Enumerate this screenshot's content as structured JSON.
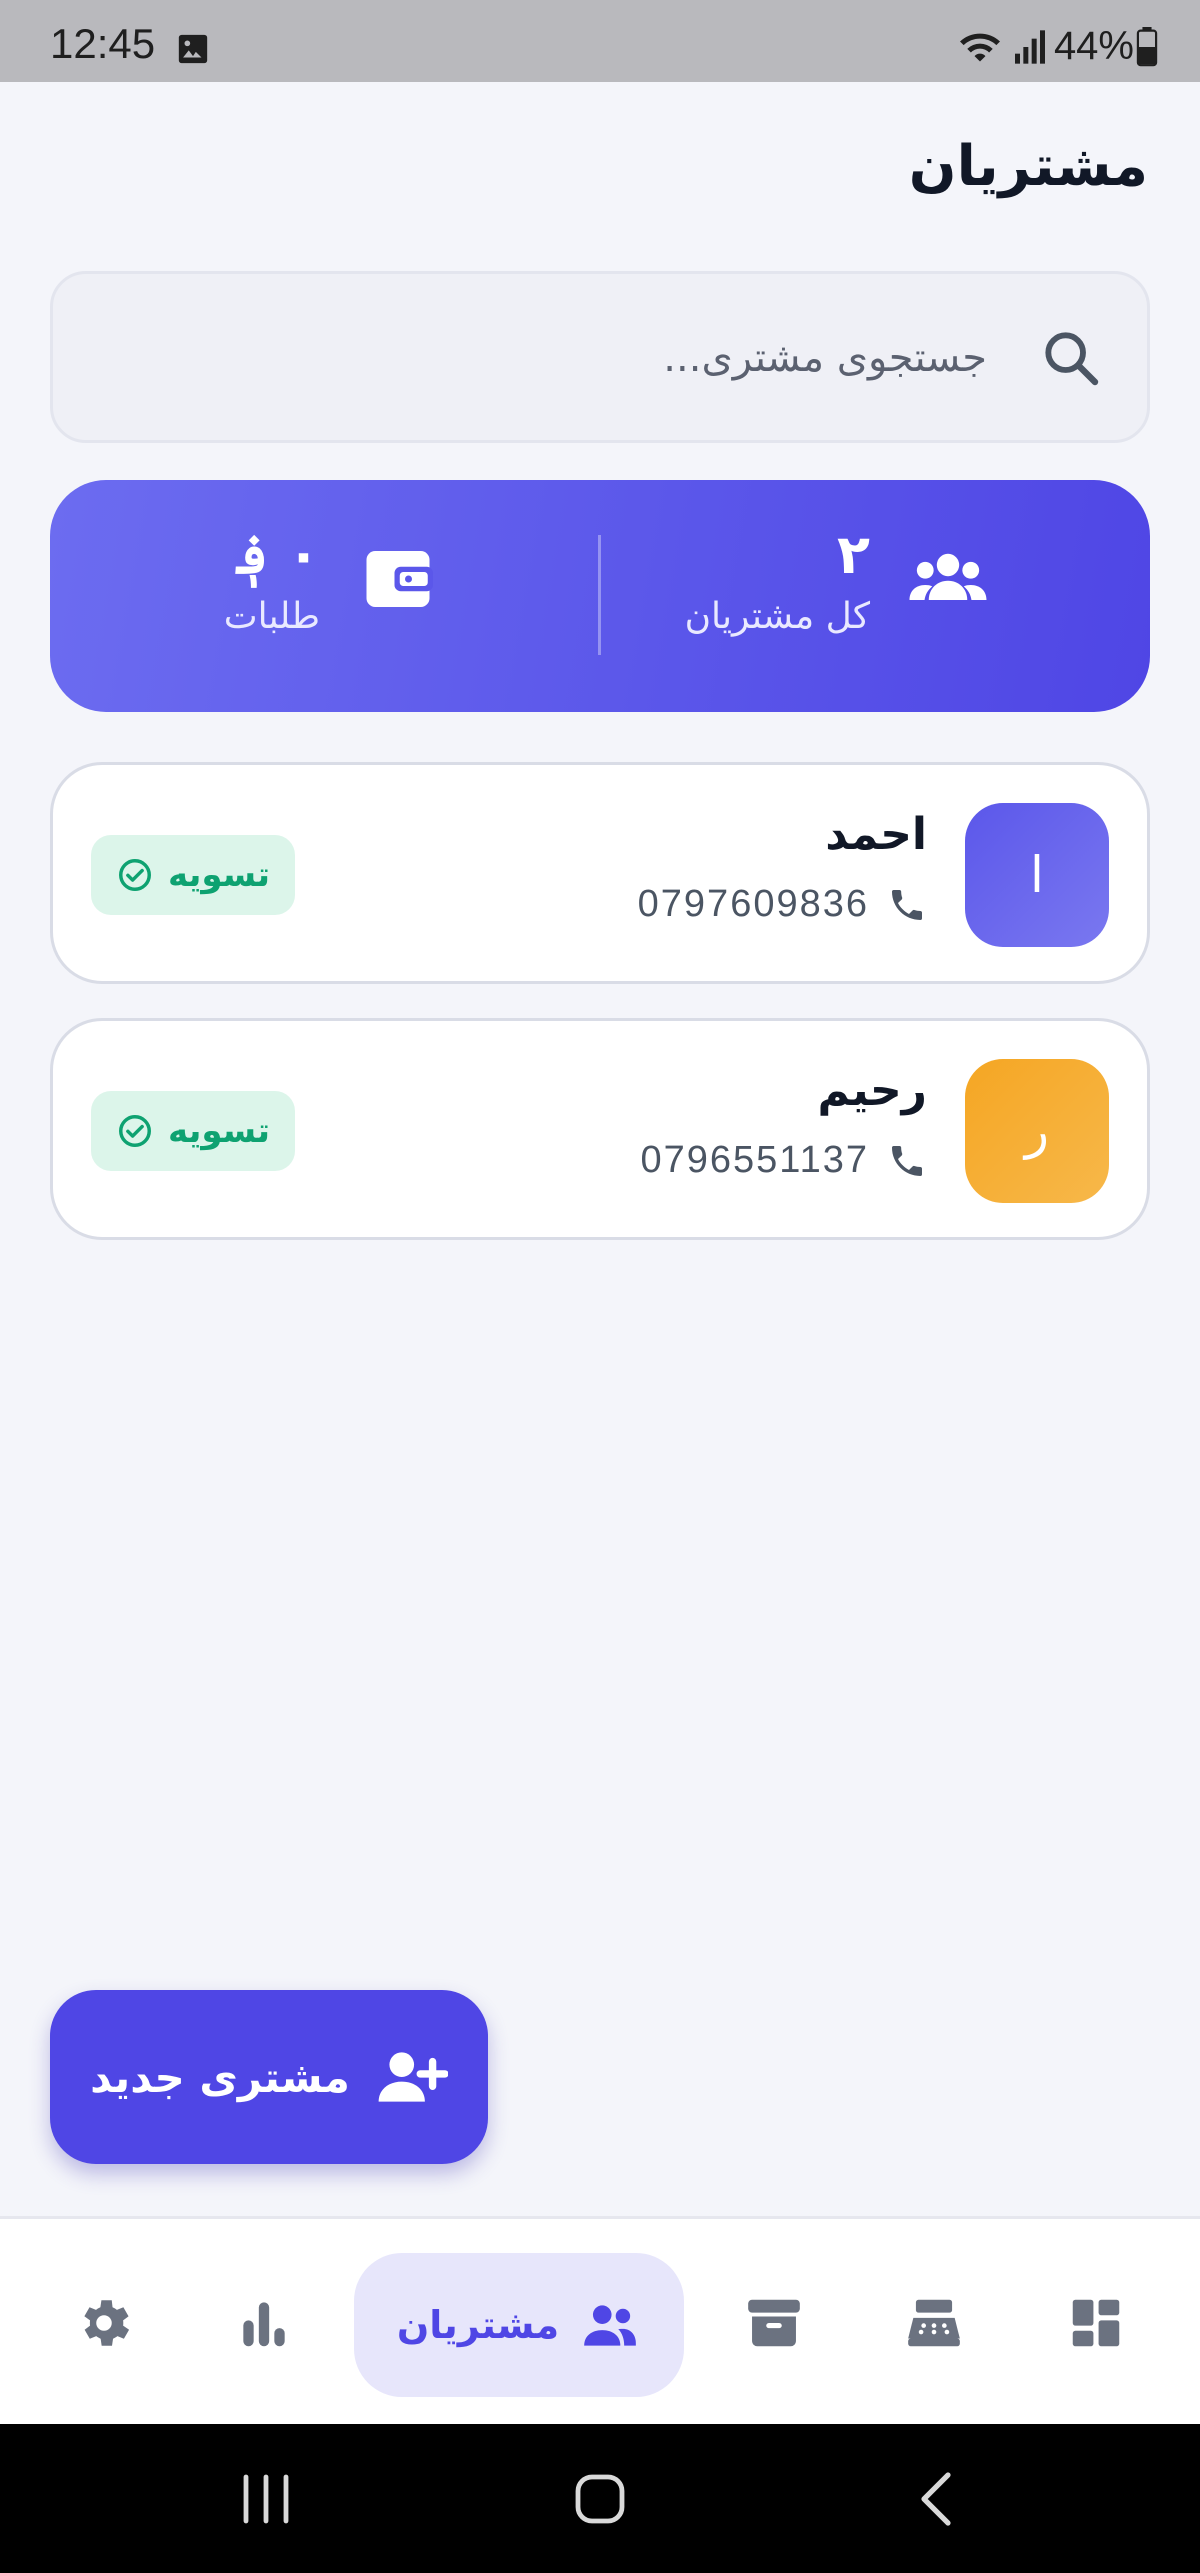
{
  "status_bar": {
    "time": "12:45",
    "battery": "44%"
  },
  "page": {
    "title": "مشتریان"
  },
  "search": {
    "placeholder": "جستجوی مشتری..."
  },
  "stats": {
    "customers": {
      "value": "۲",
      "label": "کل مشتریان",
      "icon": "users-icon"
    },
    "receivables": {
      "value": "۰ ؋",
      "label": "طلبات",
      "icon": "wallet-icon"
    }
  },
  "customers": [
    {
      "initial": "ا",
      "name": "احمد",
      "phone": "0797609836",
      "status": "تسویه",
      "avatar_color": "#5b57ea"
    },
    {
      "initial": "ر",
      "name": "رحیم",
      "phone": "0796551137",
      "status": "تسویه",
      "avatar_color": "#f5a623"
    }
  ],
  "fab": {
    "label": "مشتری جدید",
    "icon": "person-add-icon"
  },
  "nav": {
    "items": [
      {
        "icon": "dashboard-icon"
      },
      {
        "icon": "cash-register-icon"
      },
      {
        "icon": "archive-box-icon"
      },
      {
        "icon": "users-icon",
        "label": "مشتریان",
        "active": true
      },
      {
        "icon": "bar-chart-icon"
      },
      {
        "icon": "gear-icon"
      }
    ]
  },
  "colors": {
    "accent": "#4f46e5",
    "success": "#0ea271",
    "success_bg": "#dcf5ea"
  }
}
